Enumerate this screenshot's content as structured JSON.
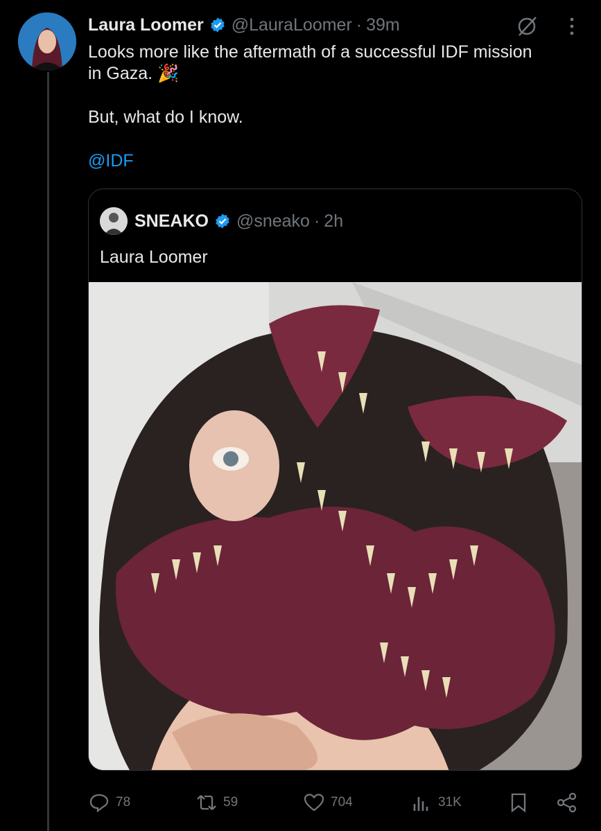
{
  "post": {
    "author_name": "Laura Loomer",
    "handle": "@LauraLoomer",
    "separator": "·",
    "time": "39m",
    "text_line1": "Looks more like the aftermath of a successful IDF mission",
    "text_line2": "in Gaza. 🎉",
    "text_line3": "But, what do I know.",
    "mention": "@IDF"
  },
  "quote": {
    "author_name": "SNEAKO",
    "handle": "@sneako",
    "separator": "·",
    "time": "2h",
    "text": "Laura Loomer",
    "media_icon": "horror-makeup-photo"
  },
  "actions": {
    "replies": "78",
    "reposts": "59",
    "likes": "704",
    "views": "31K"
  },
  "icons": {
    "verified": "verified-badge-icon",
    "grok": "grok-icon",
    "more": "more-icon",
    "reply": "reply-icon",
    "repost": "repost-icon",
    "like": "like-icon",
    "views": "views-icon",
    "bookmark": "bookmark-icon",
    "share": "share-icon"
  },
  "colors": {
    "background": "#000000",
    "text": "#e7e9ea",
    "muted": "#71767b",
    "accent": "#1d9bf0",
    "border": "#2f3336"
  }
}
